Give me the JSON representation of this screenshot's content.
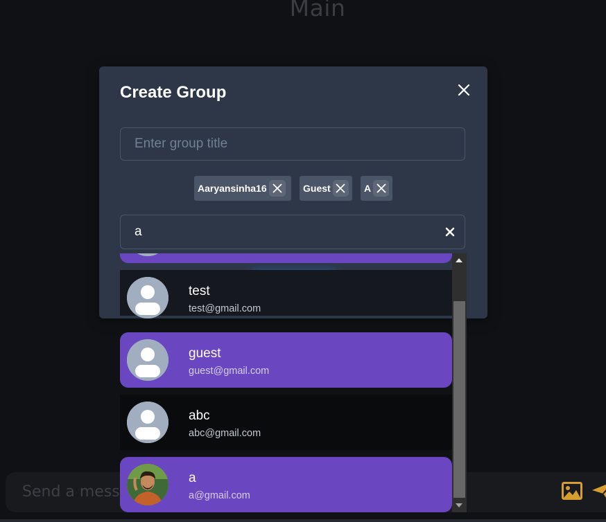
{
  "page": {
    "title": "Main"
  },
  "message_bar": {
    "placeholder": "Send a message..."
  },
  "modal": {
    "title": "Create Group",
    "title_input": {
      "placeholder": "Enter group title",
      "value": ""
    },
    "selected_users": [
      "Aaryansinha16",
      "Guest",
      "A"
    ],
    "search": {
      "value": "a"
    },
    "submit_label": "Create Group"
  },
  "results": [
    {
      "name": "",
      "email": "",
      "avatar": "default-avatar-icon",
      "highlighted": true
    },
    {
      "name": "test",
      "email": "test@gmail.com",
      "avatar": "default-avatar-icon",
      "highlighted": false
    },
    {
      "name": "guest",
      "email": "guest@gmail.com",
      "avatar": "default-avatar-icon",
      "highlighted": true
    },
    {
      "name": "abc",
      "email": "abc@gmail.com",
      "avatar": "default-avatar-icon",
      "highlighted": false
    },
    {
      "name": "a",
      "email": "a@gmail.com",
      "avatar": "profile-photo",
      "highlighted": true
    }
  ],
  "colors": {
    "background": "#101114",
    "modal": "#2d3748",
    "chip": "#4a5568",
    "highlight": "#6b46c1",
    "icon_accent": "#d69e2e"
  }
}
